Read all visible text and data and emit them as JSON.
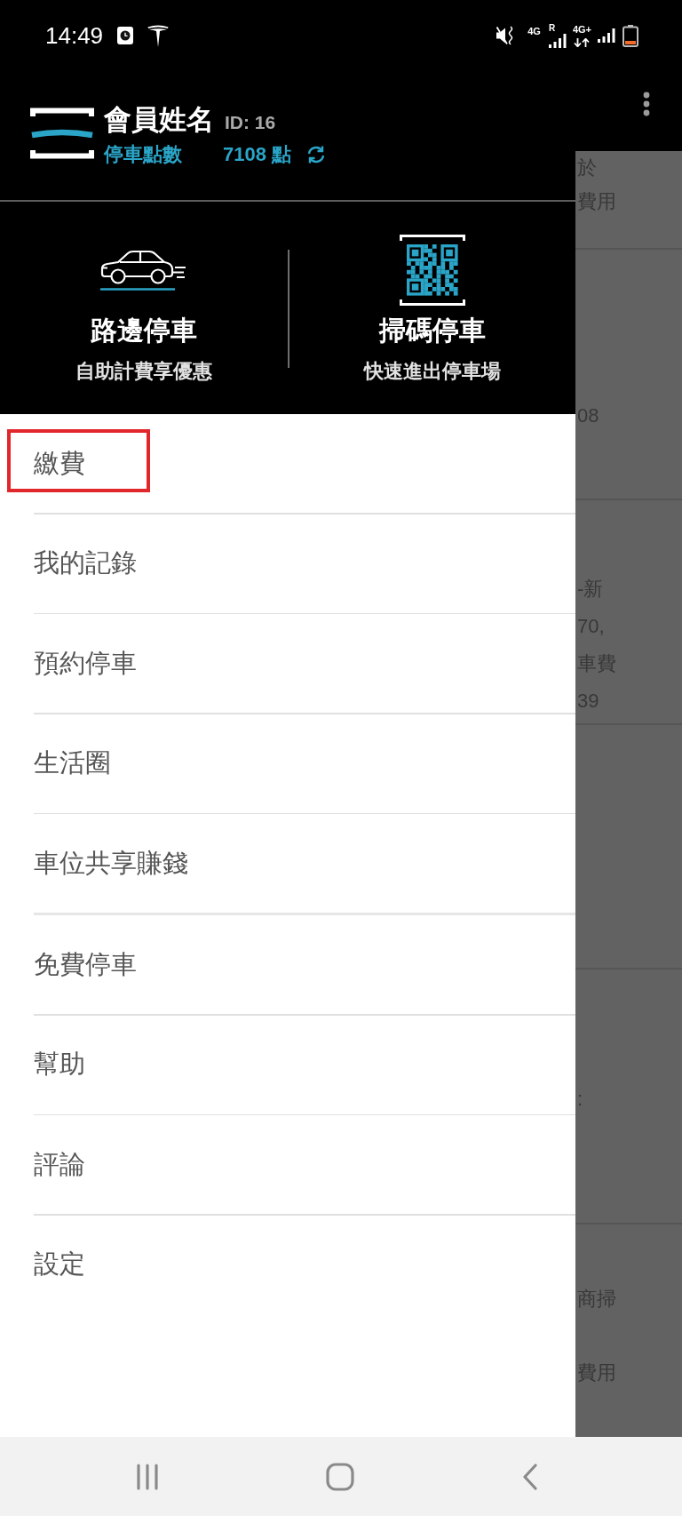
{
  "status_bar": {
    "time": "14:49",
    "network_indicators": [
      {
        "network": "4G",
        "roaming": "R"
      },
      {
        "network": "4G+"
      }
    ]
  },
  "drawer": {
    "user": {
      "name": "會員姓名",
      "id": "ID: 16",
      "points_label": "停車點數",
      "points": "7108 點"
    },
    "shortcuts": [
      {
        "kind": "car",
        "title": "路邊停車",
        "subtitle": "自助計費享優惠"
      },
      {
        "kind": "qr",
        "title": "掃碼停車",
        "subtitle": "快速進出停車場"
      }
    ],
    "menu": [
      {
        "items": [
          {
            "label": "繳費",
            "highlighted": true
          },
          {
            "label": "我的記錄",
            "highlighted": false
          },
          {
            "label": "預約停車",
            "highlighted": false
          },
          {
            "label": "生活圈",
            "highlighted": false
          },
          {
            "label": "車位共享賺錢",
            "highlighted": false
          }
        ]
      },
      {
        "items": [
          {
            "label": "免費停車",
            "highlighted": false
          },
          {
            "label": "幫助",
            "highlighted": false
          },
          {
            "label": "評論",
            "highlighted": false
          },
          {
            "label": "設定",
            "highlighted": false
          }
        ]
      }
    ]
  },
  "background_list": {
    "cards": [
      {
        "lines": [
          "於",
          "費用"
        ]
      },
      {
        "lines": [
          "08"
        ]
      },
      {
        "lines": [
          "-新",
          "70,",
          "車費",
          "39"
        ]
      },
      {
        "lines": [
          ":"
        ]
      },
      {
        "lines": [
          "商掃",
          "費用"
        ]
      }
    ]
  }
}
